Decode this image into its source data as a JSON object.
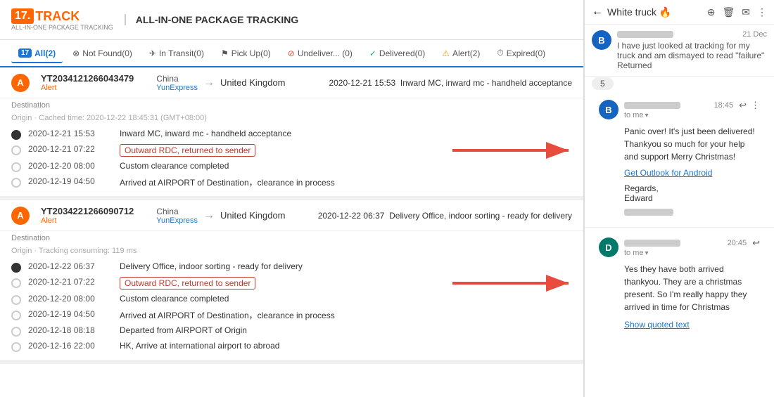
{
  "header": {
    "logo_num": "17.",
    "logo_track": "TRACK",
    "logo_subtitle": "ALL-IN-ONE PACKAGE TRACKING",
    "title": "ALL-IN-ONE PACKAGE TRACKING"
  },
  "tabs": [
    {
      "id": "all",
      "label": "All(2)",
      "icon": "17",
      "active": true
    },
    {
      "id": "not-found",
      "label": "Not Found(0)",
      "icon": "⊗"
    },
    {
      "id": "in-transit",
      "label": "In Transit(0)",
      "icon": "✈"
    },
    {
      "id": "pick-up",
      "label": "Pick Up(0)",
      "icon": "⚑"
    },
    {
      "id": "undelivered",
      "label": "Undeliver... (0)",
      "icon": "⊘"
    },
    {
      "id": "delivered",
      "label": "Delivered(0)",
      "icon": "✓"
    },
    {
      "id": "alert",
      "label": "Alert(2)",
      "icon": "⚠"
    },
    {
      "id": "expired",
      "label": "Expired(0)",
      "icon": "⏱"
    }
  ],
  "packages": [
    {
      "id": "YT2034121266043479",
      "status": "Alert",
      "origin": "China",
      "carrier": "YunExpress",
      "destination": "United Kingdom",
      "last_event_date": "2020-12-21 15:53",
      "last_event_desc": "Inward MC, inward mc - handheld acceptance",
      "section_destination": "Destination",
      "section_origin": "Origin",
      "cached_time": "Cached time: 2020-12-22 18:45:31 (GMT+08:00)",
      "events": [
        {
          "date": "2020-12-21 15:53",
          "desc": "Inward MC, inward mc - handheld acceptance",
          "type": "filled"
        },
        {
          "date": "2020-12-21 07:22",
          "desc": "Outward RDC, returned to sender",
          "type": "highlighted"
        },
        {
          "date": "2020-12-20 08:00",
          "desc": "Custom clearance completed",
          "type": "normal"
        },
        {
          "date": "2020-12-19 04:50",
          "desc": "Arrived at AIRPORT of Destination，clearance in process",
          "type": "normal"
        }
      ]
    },
    {
      "id": "YT2034221266090712",
      "status": "Alert",
      "origin": "China",
      "carrier": "YunExpress",
      "destination": "United Kingdom",
      "last_event_date": "2020-12-22 06:37",
      "last_event_desc": "Delivery Office, indoor sorting - ready for delivery",
      "section_destination": "Destination",
      "section_origin": "Origin",
      "cached_time": "Tracking consuming: 119 ms",
      "events": [
        {
          "date": "2020-12-22 06:37",
          "desc": "Delivery Office, indoor sorting - ready for delivery",
          "type": "filled"
        },
        {
          "date": "2020-12-21 07:22",
          "desc": "Outward RDC, returned to sender",
          "type": "highlighted"
        },
        {
          "date": "2020-12-20 08:00",
          "desc": "Custom clearance completed",
          "type": "normal"
        },
        {
          "date": "2020-12-19 04:50",
          "desc": "Arrived at AIRPORT of Destination，clearance in process",
          "type": "normal"
        },
        {
          "date": "2020-12-18 08:18",
          "desc": "Departed from AIRPORT of Origin",
          "type": "normal"
        },
        {
          "date": "2020-12-16 22:00",
          "desc": "HK, Arrive at international airport to abroad",
          "type": "normal"
        }
      ]
    }
  ],
  "email": {
    "title": "White truck 🔥",
    "thread": [
      {
        "avatar_letter": "B",
        "avatar_color": "blue",
        "date": "21 Dec",
        "preview": "I have just looked at tracking for my truck and am dismayed to read \"failure\" Returned",
        "count": 5
      },
      {
        "avatar_letter": "B",
        "avatar_color": "blue",
        "time": "18:45",
        "to_me": "to me",
        "body": "Panic over! It's just been delivered! Thankyou so much for your help and support Merry Christmas!",
        "outlook_link": "Get Outlook for Android",
        "regards": "Regards,\nEdward"
      },
      {
        "avatar_letter": "D",
        "avatar_color": "teal",
        "time": "20:45",
        "to_me": "to me",
        "body": "Yes they have both arrived thankyou. They are a christmas present. So I'm really happy they arrived in time for Christmas",
        "show_quoted": "Show quoted text"
      }
    ]
  }
}
